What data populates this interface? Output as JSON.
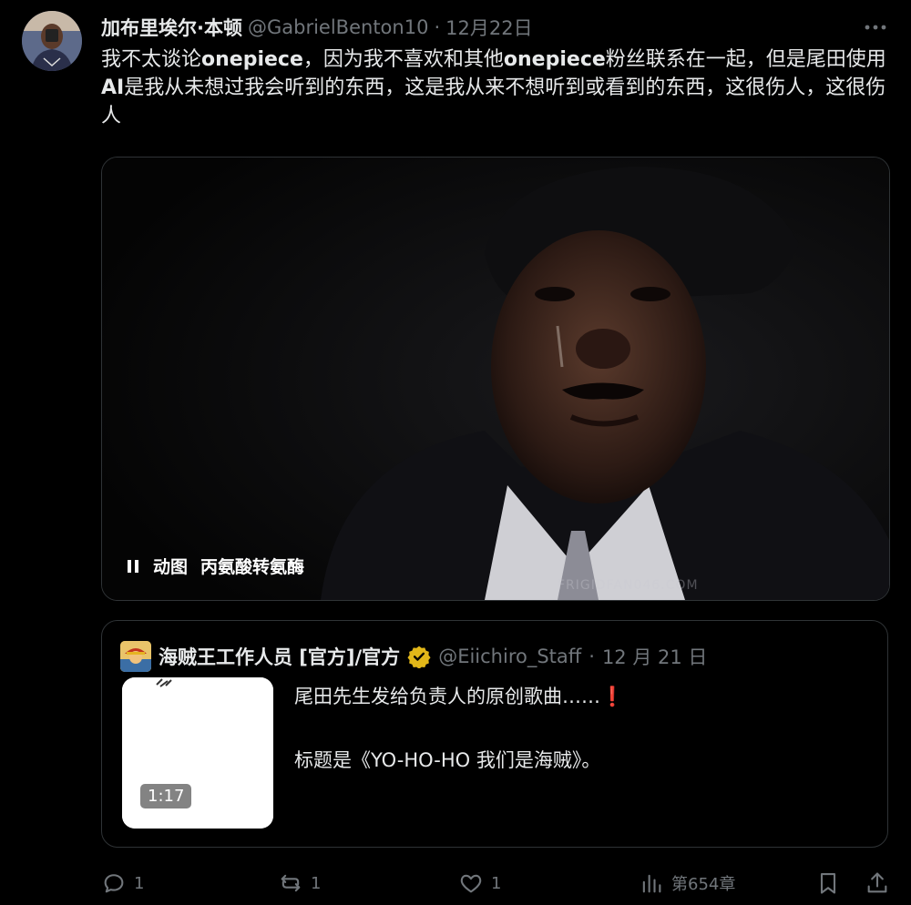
{
  "author": {
    "display_name": "加布里埃尔·本顿",
    "handle": "@GabrielBenton10",
    "separator": "·",
    "date": "12月22日"
  },
  "tweet": {
    "text_parts": [
      "我不太谈论",
      "onepiece",
      "，因为我不喜欢和其他",
      "onepiece",
      "粉丝联系在一起，但是尾田使用",
      "AI",
      "是我从未想过我会听到的东西，这是我从来不想听到或看到的东西，这很伤人，这很伤人"
    ]
  },
  "media": {
    "gif_label": "动图",
    "alt_label": "丙氨酸转氨酶",
    "watermark": "FRIGIDFAN046.COM"
  },
  "quote": {
    "display_name": "海贼王工作人员 [官方]/官方",
    "handle": "@Eiichiro_Staff",
    "separator": "·",
    "date": "12 月 21 日",
    "line1": "尾田先生发给负责人的原创歌曲……",
    "line1_emoji": "❗",
    "line2": "标题是《YO-HO-HO 我们是海贼》。",
    "duration": "1:17"
  },
  "actions": {
    "replies": "1",
    "reposts": "1",
    "likes": "1",
    "views": "第654章"
  },
  "colors": {
    "background": "#000000",
    "text": "#e7e9ea",
    "muted": "#71767b",
    "border": "#2f3336",
    "verified": "#e2b719"
  },
  "icons": [
    "more-icon",
    "pause-icon",
    "verified-badge-icon",
    "reply-icon",
    "repost-icon",
    "like-icon",
    "views-icon",
    "bookmark-icon",
    "share-icon"
  ]
}
